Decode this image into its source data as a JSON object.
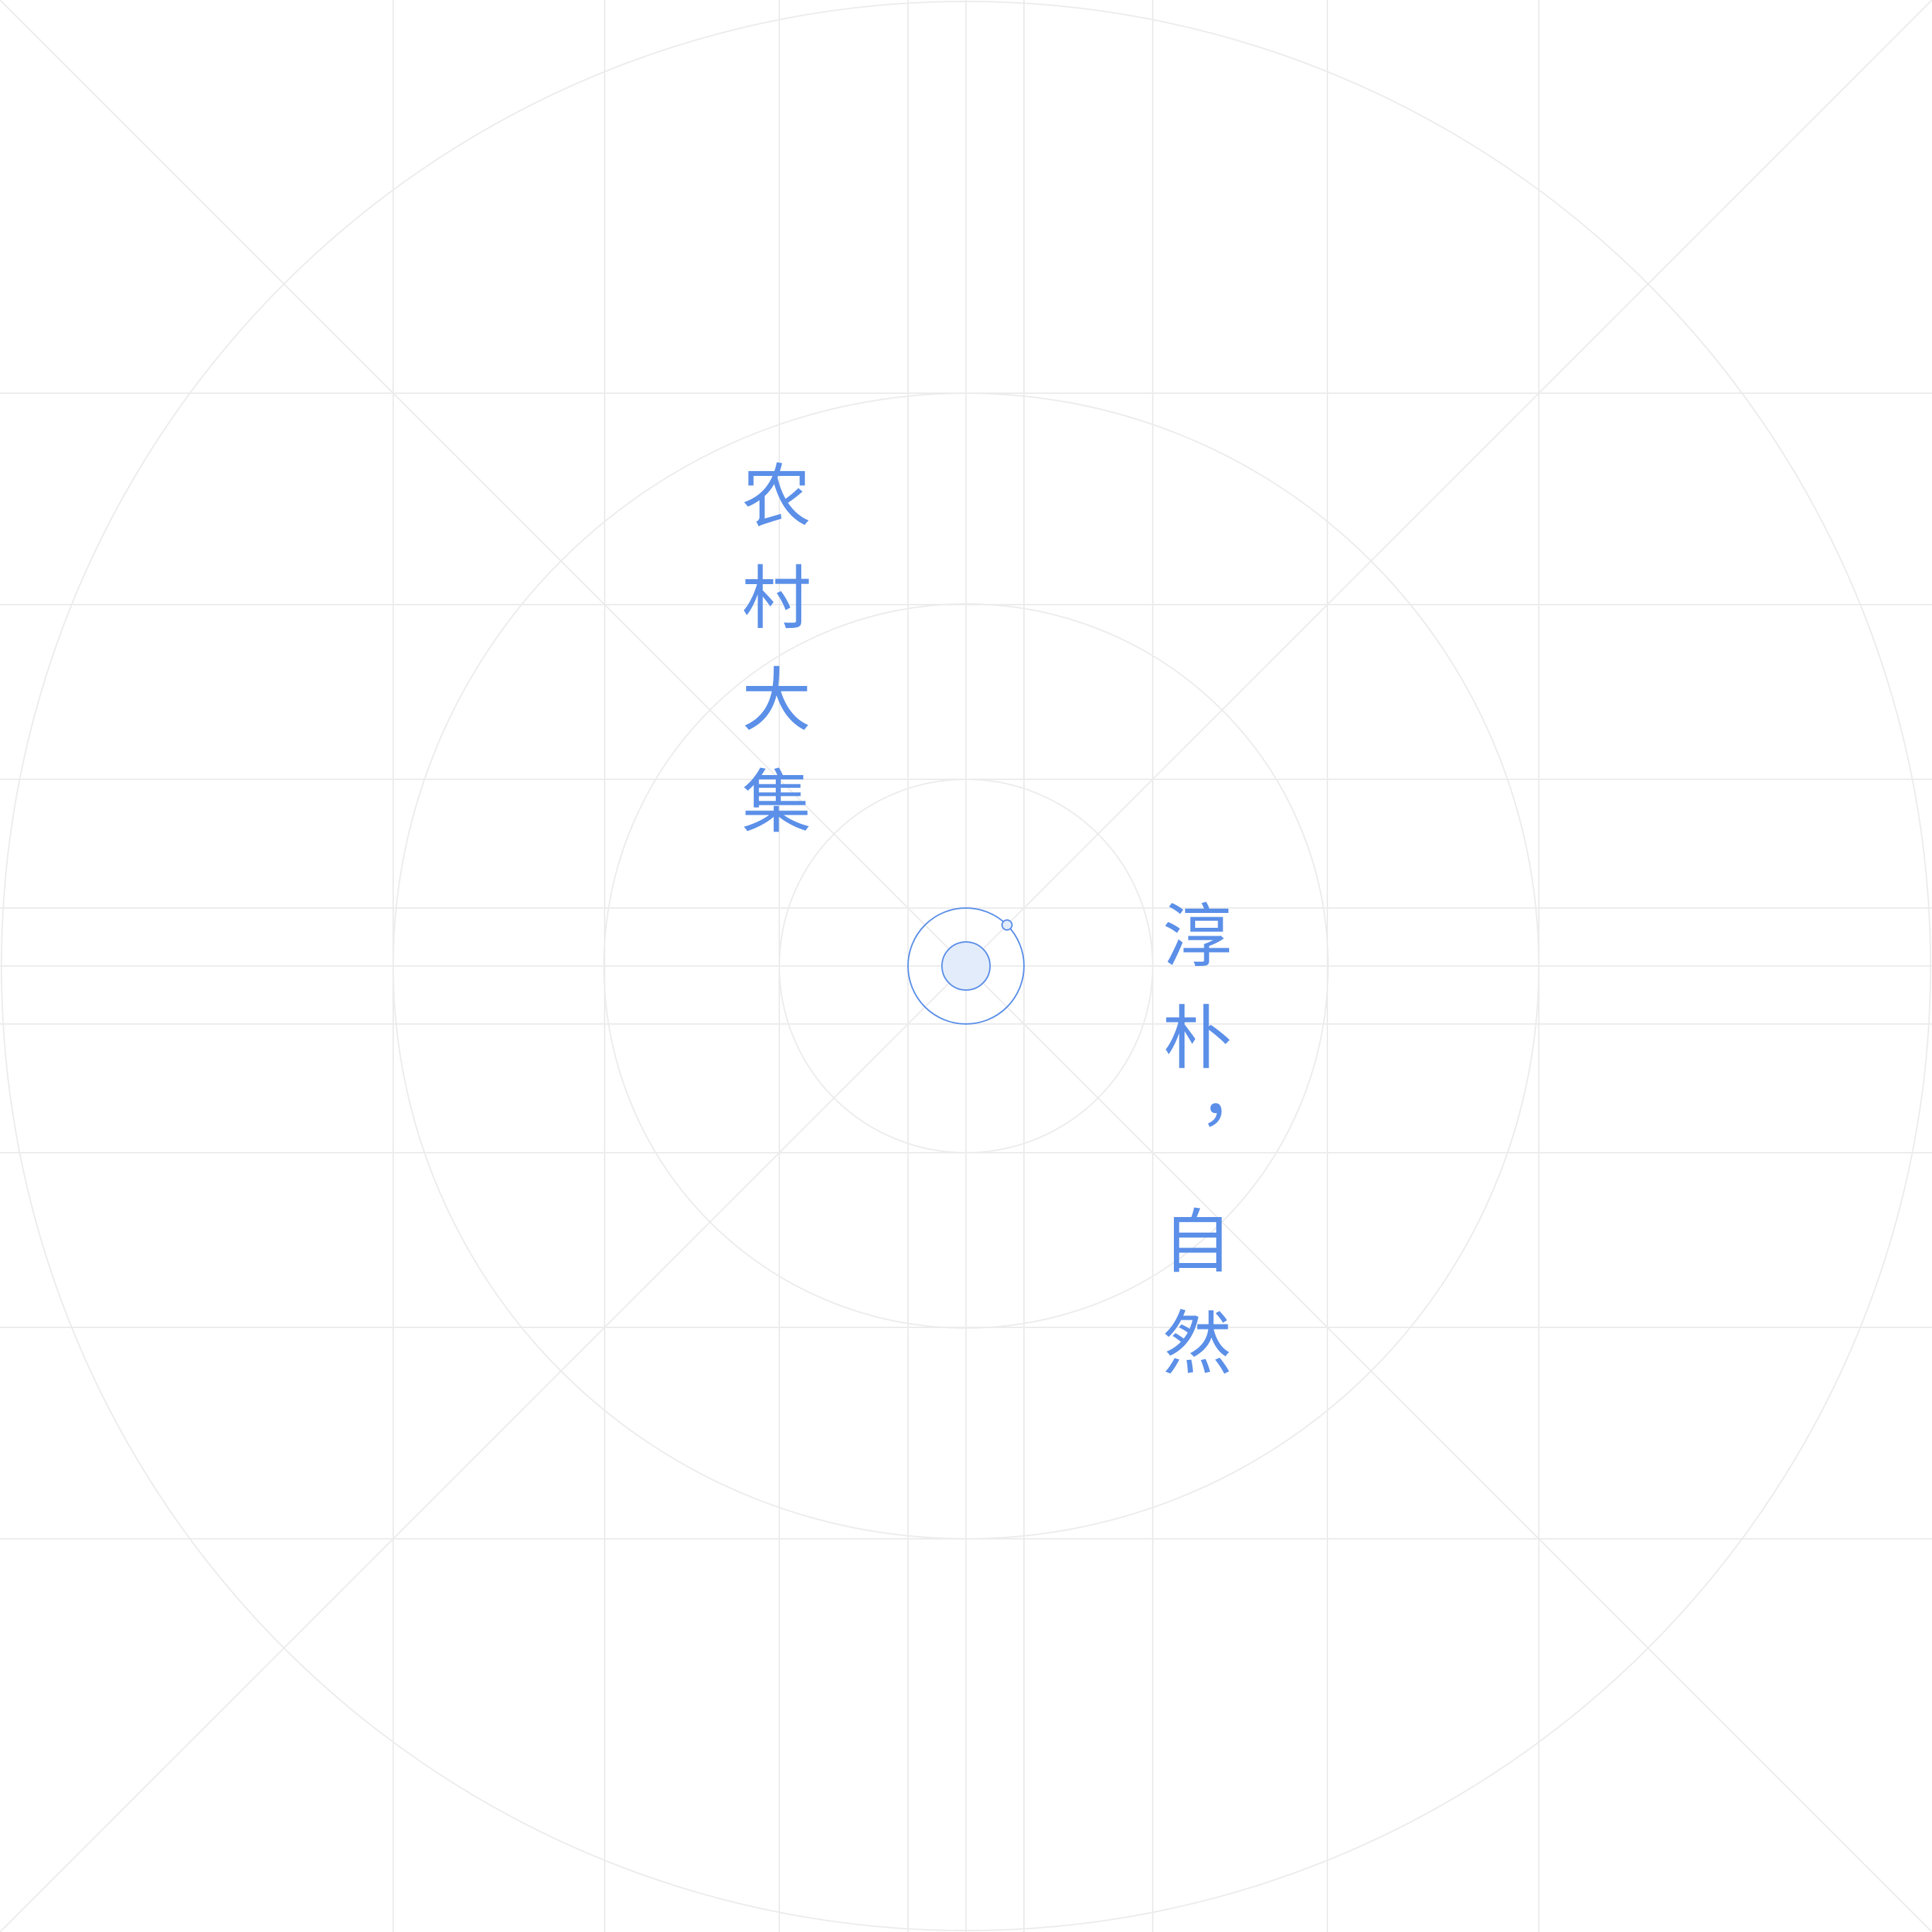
{
  "colors": {
    "accent": "#5b8fe8",
    "accent_fill": "#e3ecfb",
    "grid": "#ececec"
  },
  "icons": {
    "center": "orbit-target-icon"
  },
  "text": {
    "left_vertical": "农村大集",
    "right_vertical": "淳朴，自然"
  }
}
